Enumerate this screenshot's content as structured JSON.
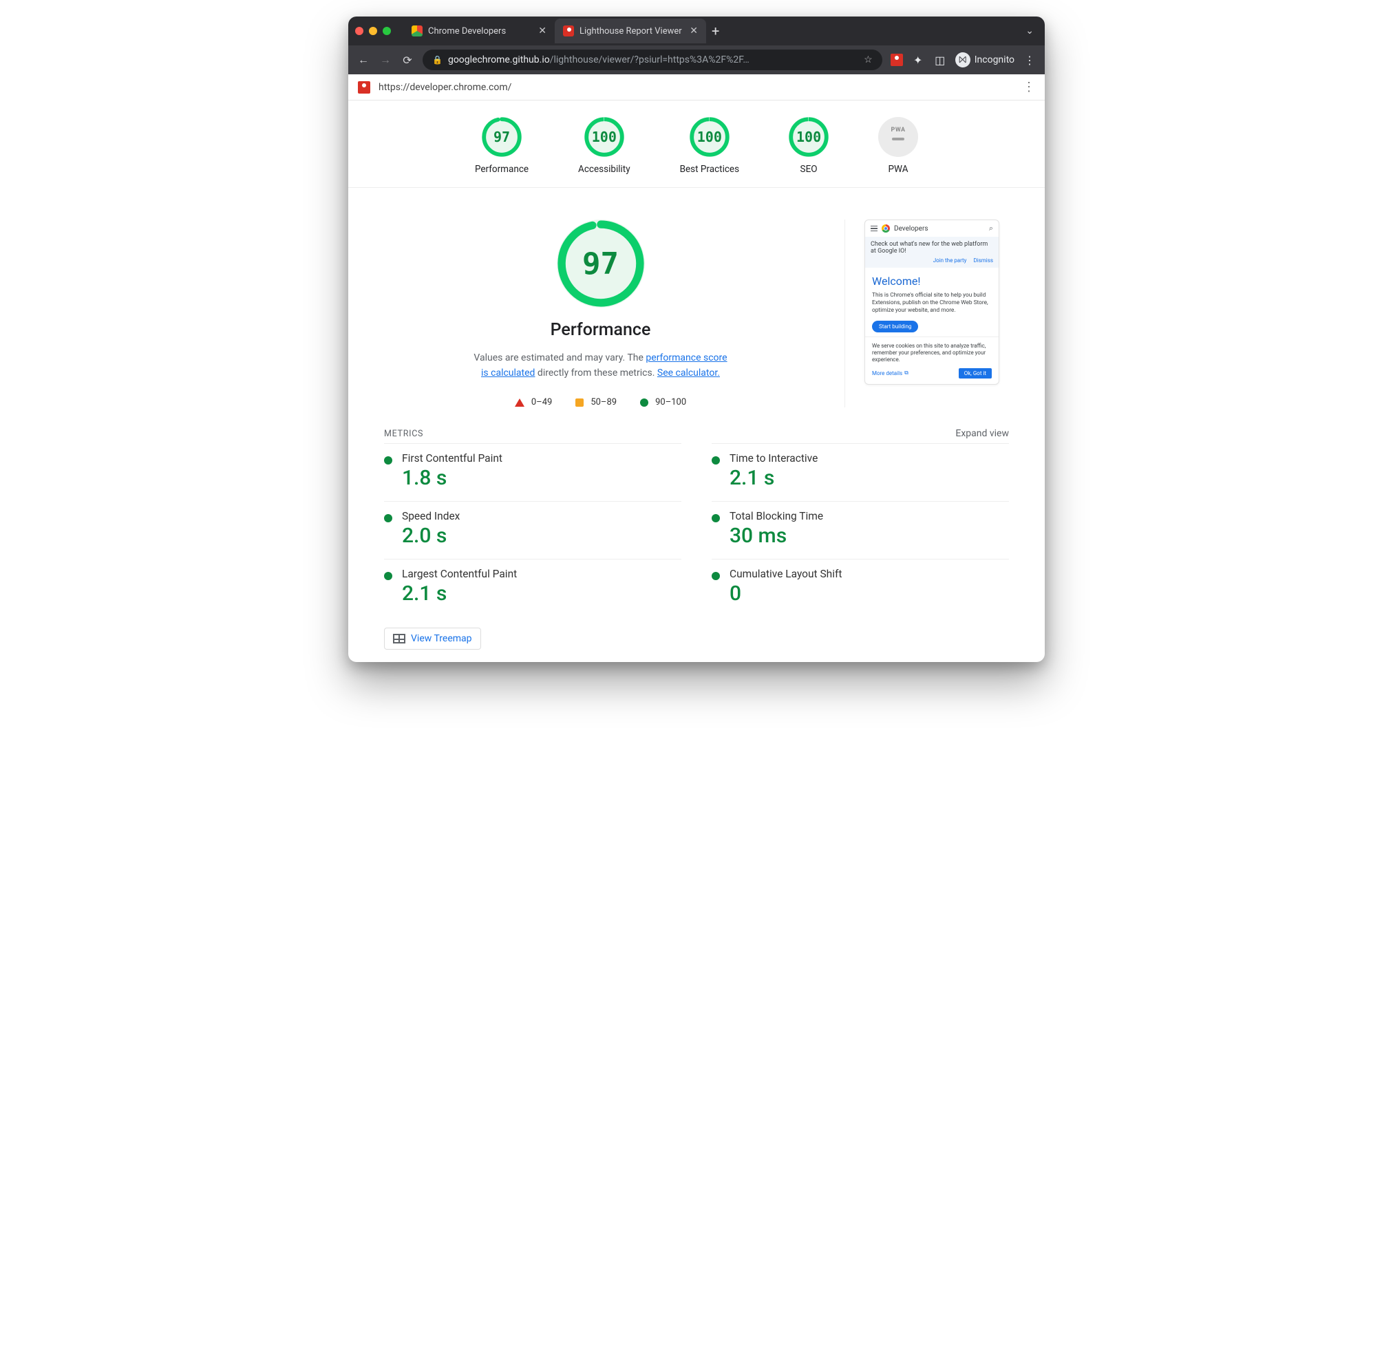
{
  "browser": {
    "tabs": [
      {
        "label": "Chrome Developers",
        "active": false
      },
      {
        "label": "Lighthouse Report Viewer",
        "active": true
      }
    ],
    "url_host": "googlechrome.github.io",
    "url_path": "/lighthouse/viewer/?psiurl=https%3A%2F%2F…",
    "incognito_label": "Incognito"
  },
  "subheader": {
    "tested_url": "https://developer.chrome.com/"
  },
  "gauges": [
    {
      "label": "Performance",
      "score": "97"
    },
    {
      "label": "Accessibility",
      "score": "100"
    },
    {
      "label": "Best Practices",
      "score": "100"
    },
    {
      "label": "SEO",
      "score": "100"
    },
    {
      "label": "PWA",
      "score": "PWA",
      "na": true
    }
  ],
  "performance": {
    "big_score": "97",
    "heading": "Performance",
    "desc_prefix": "Values are estimated and may vary. The ",
    "desc_link1": "performance score is calculated",
    "desc_mid": " directly from these metrics. ",
    "desc_link2": "See calculator.",
    "legend": {
      "poor": "0–49",
      "avg": "50–89",
      "good": "90–100"
    }
  },
  "preview": {
    "brand": "Developers",
    "banner_text": "Check out what's new for the web platform at Google IO!",
    "banner_cta": "Join the party",
    "banner_dismiss": "Dismiss",
    "welcome_heading": "Welcome!",
    "welcome_body": "This is Chrome's official site to help you build Extensions, publish on the Chrome Web Store, optimize your website, and more.",
    "start_btn": "Start building",
    "cookies_text": "We serve cookies on this site to analyze traffic, remember your preferences, and optimize your experience.",
    "more_details": "More details",
    "ok_btn": "Ok, Got it"
  },
  "metrics": {
    "section_label": "METRICS",
    "expand_label": "Expand view",
    "items": [
      {
        "name": "First Contentful Paint",
        "value": "1.8 s"
      },
      {
        "name": "Time to Interactive",
        "value": "2.1 s"
      },
      {
        "name": "Speed Index",
        "value": "2.0 s"
      },
      {
        "name": "Total Blocking Time",
        "value": "30 ms"
      },
      {
        "name": "Largest Contentful Paint",
        "value": "2.1 s"
      },
      {
        "name": "Cumulative Layout Shift",
        "value": "0"
      }
    ],
    "treemap_label": "View Treemap"
  }
}
